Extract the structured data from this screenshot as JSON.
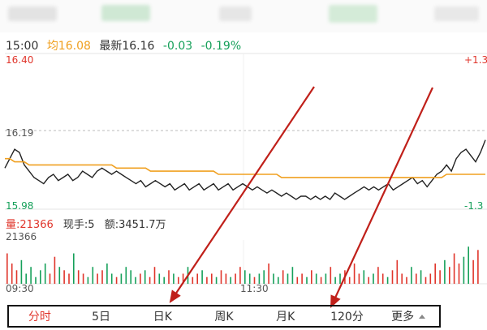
{
  "info": {
    "time": "15:00",
    "avg_label": "均16.08",
    "latest_label": "最新16.16",
    "change": "-0.03",
    "change_pct": "-0.19%"
  },
  "price_axis": {
    "top": "16.40",
    "mid": "16.19",
    "bottom": "15.98",
    "top_pct": "+1.3",
    "bottom_pct": "-1.3"
  },
  "volume": {
    "vol_label": "量:21366",
    "hand_label": "现手:5",
    "amount_label": "额:3451.7万",
    "axis_max": "21366"
  },
  "time_axis": {
    "start": "09:30",
    "mid": "11:30"
  },
  "tabs": [
    {
      "label": "分时",
      "active": true
    },
    {
      "label": "5日",
      "active": false
    },
    {
      "label": "日K",
      "active": false
    },
    {
      "label": "周K",
      "active": false
    },
    {
      "label": "月K",
      "active": false
    },
    {
      "label": "120分",
      "active": false
    },
    {
      "label": "更多",
      "active": false
    }
  ],
  "colors": {
    "up": "#e0352b",
    "down": "#16a05a",
    "avg_line": "#f0a020",
    "price_line": "#222222",
    "annotation": "#c0201a"
  },
  "chart_data": {
    "type": "line",
    "y_range": [
      15.98,
      16.4
    ],
    "prev_close": 16.19,
    "series": [
      {
        "values": [
          16.07,
          16.1,
          16.13,
          16.12,
          16.08,
          16.06,
          16.04,
          16.03,
          16.02,
          16.04,
          16.05,
          16.03,
          16.04,
          16.05,
          16.03,
          16.04,
          16.06,
          16.05,
          16.04,
          16.06,
          16.07,
          16.06,
          16.05,
          16.06,
          16.05,
          16.04,
          16.03,
          16.02,
          16.03,
          16.01,
          16.02,
          16.03,
          16.02,
          16.01,
          16.02,
          16.0,
          16.01,
          16.02,
          16.0,
          16.01,
          16.02,
          16.0,
          16.01,
          16.02,
          16.0,
          16.01,
          16.02,
          16.0,
          16.01,
          16.02,
          16.01,
          16.0,
          16.01,
          16.0,
          15.99,
          16.0,
          15.99,
          15.98,
          15.99,
          15.98,
          15.97,
          15.98,
          15.98,
          15.97,
          15.98,
          15.97,
          15.98,
          15.97,
          15.99,
          15.98,
          15.97,
          15.98,
          15.99,
          16.0,
          16.01,
          16.0,
          16.01,
          16.0,
          16.01,
          16.02,
          16.0,
          16.01,
          16.02,
          16.03,
          16.04,
          16.02,
          16.03,
          16.01,
          16.03,
          16.05,
          16.06,
          16.08,
          16.06,
          16.1,
          16.12,
          16.13,
          16.11,
          16.09,
          16.12,
          16.16
        ]
      },
      {
        "values": [
          16.1,
          16.1,
          16.09,
          16.09,
          16.09,
          16.08,
          16.08,
          16.08,
          16.08,
          16.08,
          16.08,
          16.08,
          16.08,
          16.08,
          16.08,
          16.08,
          16.08,
          16.08,
          16.08,
          16.08,
          16.08,
          16.08,
          16.08,
          16.07,
          16.07,
          16.07,
          16.07,
          16.07,
          16.07,
          16.07,
          16.06,
          16.06,
          16.06,
          16.06,
          16.06,
          16.06,
          16.06,
          16.06,
          16.06,
          16.06,
          16.06,
          16.06,
          16.06,
          16.06,
          16.05,
          16.05,
          16.05,
          16.05,
          16.05,
          16.05,
          16.05,
          16.05,
          16.05,
          16.05,
          16.05,
          16.05,
          16.05,
          16.04,
          16.04,
          16.04,
          16.04,
          16.04,
          16.04,
          16.04,
          16.04,
          16.04,
          16.04,
          16.04,
          16.04,
          16.04,
          16.04,
          16.04,
          16.04,
          16.04,
          16.04,
          16.04,
          16.04,
          16.04,
          16.04,
          16.04,
          16.04,
          16.04,
          16.04,
          16.04,
          16.04,
          16.04,
          16.04,
          16.04,
          16.04,
          16.04,
          16.04,
          16.05,
          16.05,
          16.05,
          16.05,
          16.05,
          16.05,
          16.05,
          16.05,
          16.05
        ]
      }
    ],
    "volume_bars": [
      9,
      6,
      4,
      7,
      3,
      5,
      2,
      4,
      6,
      3,
      8,
      5,
      4,
      3,
      9,
      4,
      3,
      2,
      5,
      3,
      4,
      6,
      3,
      2,
      3,
      5,
      4,
      2,
      3,
      4,
      2,
      5,
      3,
      2,
      4,
      3,
      2,
      3,
      5,
      2,
      3,
      4,
      2,
      3,
      2,
      4,
      3,
      2,
      3,
      5,
      4,
      3,
      2,
      3,
      4,
      6,
      3,
      2,
      4,
      3,
      5,
      2,
      3,
      2,
      4,
      3,
      2,
      3,
      5,
      2,
      3,
      4,
      2,
      6,
      3,
      4,
      2,
      3,
      5,
      3,
      2,
      4,
      7,
      3,
      2,
      5,
      3,
      4,
      2,
      3,
      6,
      4,
      7,
      5,
      9,
      6,
      8,
      11,
      7,
      10
    ]
  }
}
